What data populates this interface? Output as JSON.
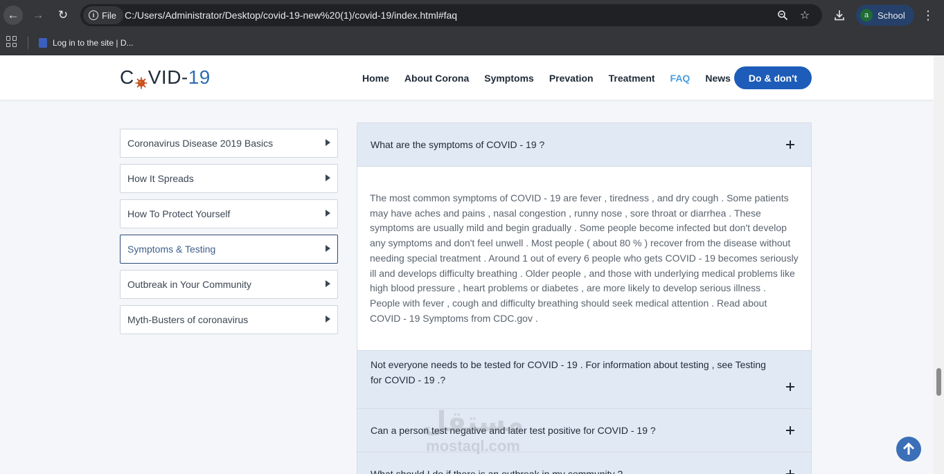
{
  "browser": {
    "site_chip": "File",
    "url": "C:/Users/Administrator/Desktop/covid-19-new%20(1)/covid-19/index.html#faq",
    "profile_initial": "a",
    "profile_name": "School",
    "bookmark": "Log in to the site | D..."
  },
  "site": {
    "logo_left": "C",
    "logo_mid": "VID-",
    "logo_num": "19",
    "nav": [
      "Home",
      "About Corona",
      "Symptoms",
      "Prevation",
      "Treatment",
      "FAQ",
      "News"
    ],
    "nav_active": "FAQ",
    "cta_label": "Do & don't"
  },
  "sidebar": {
    "items": [
      {
        "label": "Coronavirus Disease 2019 Basics"
      },
      {
        "label": "How It Spreads"
      },
      {
        "label": "How To Protect Yourself"
      },
      {
        "label": "Symptoms & Testing"
      },
      {
        "label": "Outbreak in Your Community"
      },
      {
        "label": "Myth-Busters of coronavirus"
      }
    ],
    "active_index": 3
  },
  "faq": {
    "items": [
      {
        "question": "What are the symptoms of COVID - 19 ?",
        "answer": "The most common symptoms of COVID - 19 are fever , tiredness , and dry cough . Some patients may have aches and pains , nasal congestion , runny nose , sore throat or diarrhea . These symptoms are usually mild and begin gradually . Some people become infected but don't develop any symptoms and don't feel unwell . Most people ( about 80 % ) recover from the disease without needing special treatment . Around 1 out of every 6 people who gets COVID - 19 becomes seriously ill and develops difficulty breathing . Older people , and those with underlying medical problems like high blood pressure , heart problems or diabetes , are more likely to develop serious illness . People with fever , cough and difficulty breathing should seek medical attention . Read about COVID - 19 Symptoms from CDC.gov ."
      },
      {
        "question": "Not everyone needs to be tested for COVID - 19 . For information about testing , see Testing for COVID - 19 .?"
      },
      {
        "question": "Can a person test negative and later test positive for COVID - 19 ?"
      },
      {
        "question": "What should I do if there is an outbreak in my community ?"
      }
    ]
  },
  "watermark": {
    "arabic": "مستقل",
    "latin": "mostaql.com"
  },
  "colors": {
    "accent": "#1d5cb8",
    "faq_header": "#e1e9f5",
    "active_nav": "#4a9ee0"
  }
}
